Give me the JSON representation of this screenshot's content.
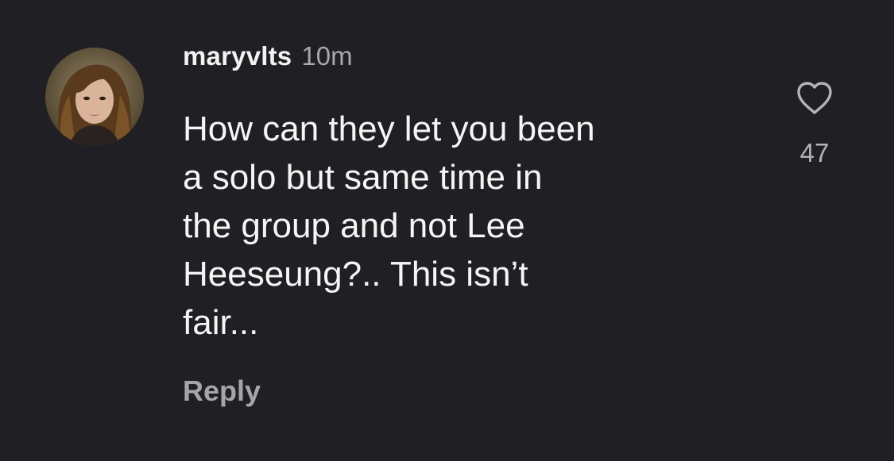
{
  "comment": {
    "username": "maryvlts",
    "timestamp": "10m",
    "text": "How can they let you been\na solo but same time in\nthe group and not Lee\nHeeseung?.. This isn’t\nfair...",
    "reply_label": "Reply",
    "like_count": "47",
    "avatar_icon": "profile-photo",
    "like_icon": "heart-outline-icon"
  },
  "colors": {
    "background": "#202024",
    "text": "#f5f5f5",
    "muted": "#a8a8ac"
  }
}
